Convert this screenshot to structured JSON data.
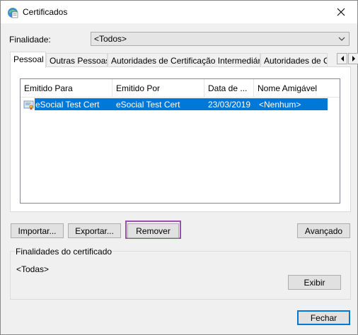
{
  "window": {
    "title": "Certificados"
  },
  "purpose": {
    "label": "Finalidade:",
    "selected": "<Todos>"
  },
  "tabs": [
    {
      "label": "Pessoal",
      "active": true
    },
    {
      "label": "Outras Pessoas"
    },
    {
      "label": "Autoridades de Certificação Intermediárias"
    },
    {
      "label": "Autoridades de Ce"
    }
  ],
  "table": {
    "columns": [
      "Emitido Para",
      "Emitido Por",
      "Data de ...",
      "Nome Amigável"
    ],
    "rows": [
      {
        "issued_to": "eSocial Test Cert",
        "issued_by": "eSocial Test Cert",
        "date": "23/03/2019",
        "friendly_name": "<Nenhum>",
        "selected": true
      }
    ]
  },
  "buttons": {
    "import": "Importar...",
    "export": "Exportar...",
    "remove": "Remover",
    "advanced": "Avançado",
    "view": "Exibir",
    "close": "Fechar"
  },
  "purposes_group": {
    "title": "Finalidades do certificado",
    "value": "<Todas>"
  },
  "colors": {
    "selection": "#0078d7",
    "highlight": "#9a4fae"
  }
}
